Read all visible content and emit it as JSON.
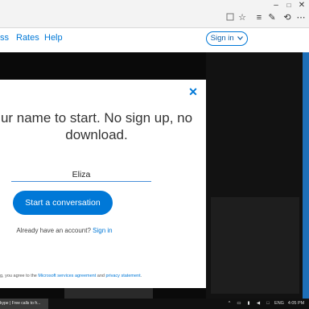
{
  "browser": {
    "window_controls": {
      "minimize": "–",
      "maximize": "□",
      "close": "✕"
    },
    "toolbar_icons": [
      "reading-view-icon",
      "favorite-star-icon",
      "hub-icon",
      "web-note-icon",
      "share-icon",
      "more-icon"
    ]
  },
  "site_nav": {
    "links": [
      "ss",
      "Rates",
      "Help"
    ],
    "signin_label": "Sign in"
  },
  "modal": {
    "headline": "ur name to start. No sign up, no download.",
    "name_value": "Eliza",
    "start_button": "Start a conversation",
    "account_prompt": "Already have an account?",
    "account_link": "Sign in",
    "terms_prefix": "g, you agree to the",
    "terms_link1": "Microsoft services agreement",
    "terms_and": "and",
    "terms_link2": "privacy statement",
    "terms_suffix": "."
  },
  "taskbar": {
    "app_label": "kype | Free calls to fr...",
    "language": "ENG",
    "time": "4:05 PM"
  }
}
